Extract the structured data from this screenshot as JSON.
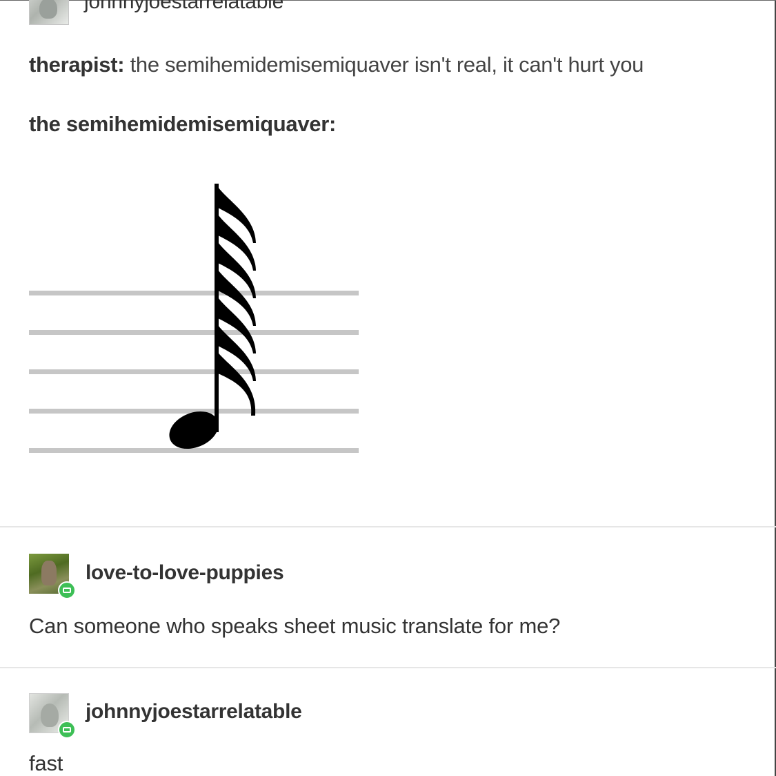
{
  "post": {
    "author": "johnnyjoestarrelatable",
    "line1_speaker": "therapist:",
    "line1_text": " the semihemidemisemiquaver isn't real, it can't hurt you",
    "line2": "the semihemidemisemiquaver:"
  },
  "music_image": {
    "note": "semihemidemisemiquaver",
    "staff_lines": 5,
    "flags": 7
  },
  "replies": [
    {
      "username": "love-to-love-puppies",
      "text": "Can someone who speaks sheet music translate for me?",
      "avatar_icon": "puppy-avatar"
    },
    {
      "username": "johnnyjoestarrelatable",
      "text": "fast",
      "avatar_icon": "anime-character-avatar"
    }
  ],
  "colors": {
    "badge_green": "#3dbf56",
    "separator": "#e6e6e6",
    "staff_line": "#c6c6c6"
  }
}
